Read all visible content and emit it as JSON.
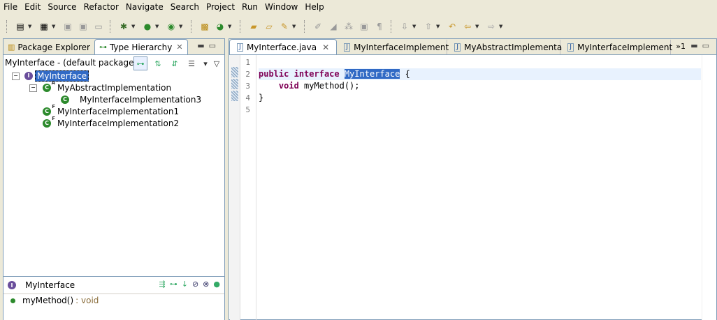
{
  "menu": [
    "File",
    "Edit",
    "Source",
    "Refactor",
    "Navigate",
    "Search",
    "Project",
    "Run",
    "Window",
    "Help"
  ],
  "left_tabs": {
    "package_explorer": "Package Explorer",
    "type_hierarchy": "Type Hierarchy"
  },
  "hierarchy": {
    "header": "MyInterface - (default package)",
    "nodes": [
      {
        "label": "MyInterface",
        "kind": "interface",
        "modifier": ""
      },
      {
        "label": "MyAbstractImplementation",
        "kind": "class",
        "modifier": "A"
      },
      {
        "label": "MyInterfaceImplementation3",
        "kind": "class",
        "modifier": ""
      },
      {
        "label": "MyInterfaceImplementation1",
        "kind": "class",
        "modifier": "F"
      },
      {
        "label": "MyInterfaceImplementation2",
        "kind": "class",
        "modifier": "F"
      }
    ]
  },
  "members": {
    "type_name": "MyInterface",
    "items": [
      {
        "name": "myMethod()",
        "return_type": ": void"
      }
    ]
  },
  "editor": {
    "tabs": [
      "MyInterface.java",
      "MyInterfaceImplement",
      "MyAbstractImplementa",
      "MyInterfaceImplement"
    ],
    "more_tabs": "»1",
    "line_numbers": [
      "1",
      "2",
      "3",
      "4",
      "5"
    ],
    "code": {
      "l2_kw1": "public",
      "l2_kw2": "interface",
      "l2_name": "MyInterface",
      "l2_brace": " {",
      "l3_kw": "void",
      "l3_rest": " myMethod();",
      "l4": "}"
    }
  },
  "colors": {
    "keyword": "#7f0055",
    "selection": "#316ac5",
    "class_icon": "#2c8a2c",
    "interface_icon": "#6a4e9c"
  }
}
